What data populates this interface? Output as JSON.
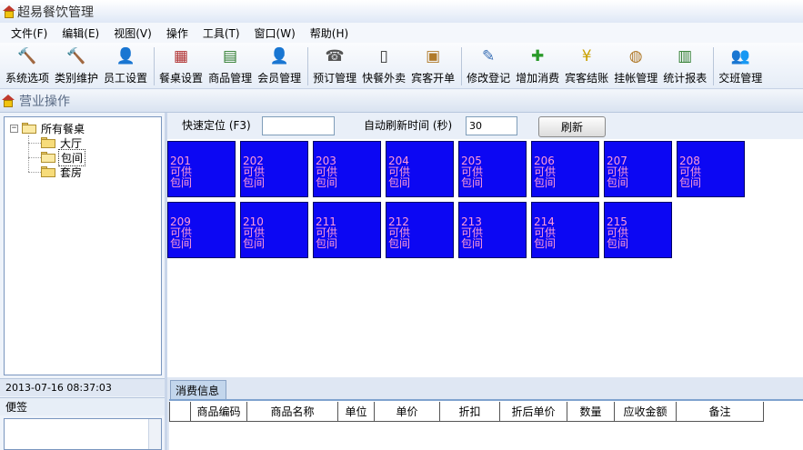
{
  "window": {
    "title": "超易餐饮管理"
  },
  "menu": [
    "文件(F)",
    "编辑(E)",
    "视图(V)",
    "操作",
    "工具(T)",
    "窗口(W)",
    "帮助(H)"
  ],
  "toolbar": {
    "buttons": [
      {
        "label": "系统选项",
        "icon": "hammer-icon"
      },
      {
        "label": "类别维护",
        "icon": "hammer-icon"
      },
      {
        "label": "员工设置",
        "icon": "person-icon"
      },
      {
        "label": "餐桌设置",
        "icon": "table-icon"
      },
      {
        "label": "商品管理",
        "icon": "goods-icon"
      },
      {
        "label": "会员管理",
        "icon": "member-icon"
      },
      {
        "label": "预订管理",
        "icon": "phone-icon"
      },
      {
        "label": "快餐外卖",
        "icon": "mobile-icon"
      },
      {
        "label": "宾客开单",
        "icon": "box-icon"
      },
      {
        "label": "修改登记",
        "icon": "edit-person-icon"
      },
      {
        "label": "增加消费",
        "icon": "add-icon"
      },
      {
        "label": "宾客结账",
        "icon": "yen-icon"
      },
      {
        "label": "挂帐管理",
        "icon": "bag-icon"
      },
      {
        "label": "统计报表",
        "icon": "chart-icon"
      },
      {
        "label": "交班管理",
        "icon": "people-icon"
      }
    ]
  },
  "section": {
    "title": "营业操作"
  },
  "tree": {
    "root": "所有餐桌",
    "children": [
      "大厅",
      "包间",
      "套房"
    ],
    "selected": "包间"
  },
  "controls": {
    "quick_locate_label": "快速定位 (F3)",
    "quick_locate_value": "",
    "auto_refresh_label": "自动刷新时间 (秒)",
    "auto_refresh_value": "30",
    "refresh_button": "刷新"
  },
  "tables": [
    {
      "number": "201",
      "status": "可供",
      "type": "包间"
    },
    {
      "number": "202",
      "status": "可供",
      "type": "包间"
    },
    {
      "number": "203",
      "status": "可供",
      "type": "包间"
    },
    {
      "number": "204",
      "status": "可供",
      "type": "包间"
    },
    {
      "number": "205",
      "status": "可供",
      "type": "包间"
    },
    {
      "number": "206",
      "status": "可供",
      "type": "包间"
    },
    {
      "number": "207",
      "status": "可供",
      "type": "包间"
    },
    {
      "number": "208",
      "status": "可供",
      "type": "包间"
    },
    {
      "number": "209",
      "status": "可供",
      "type": "包间"
    },
    {
      "number": "210",
      "status": "可供",
      "type": "包间"
    },
    {
      "number": "211",
      "status": "可供",
      "type": "包间"
    },
    {
      "number": "212",
      "status": "可供",
      "type": "包间"
    },
    {
      "number": "213",
      "status": "可供",
      "type": "包间"
    },
    {
      "number": "214",
      "status": "可供",
      "type": "包间"
    },
    {
      "number": "215",
      "status": "可供",
      "type": "包间"
    }
  ],
  "status": {
    "datetime": "2013-07-16 08:37:03"
  },
  "memo": {
    "title": "便签"
  },
  "consumption": {
    "tab": "消费信息",
    "columns": [
      "商品编码",
      "商品名称",
      "单位",
      "单价",
      "折扣",
      "折后单价",
      "数量",
      "应收金额",
      "备注"
    ]
  },
  "colors": {
    "tile_bg": "#0c07f3",
    "tile_text": "#ff9ad6"
  }
}
